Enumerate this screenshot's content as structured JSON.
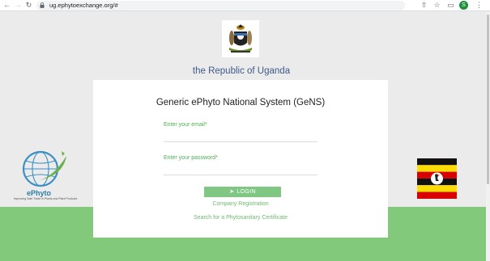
{
  "browser": {
    "url": "ug.ephytoexchange.org/#",
    "avatar_letter": "S",
    "icons": [
      "back-icon",
      "forward-icon",
      "reload-icon",
      "lock-icon",
      "share-icon",
      "star-icon",
      "sidebar-icon",
      "menu-icon"
    ]
  },
  "header": {
    "country_text": "the Republic of Uganda"
  },
  "login": {
    "title": "Generic ePhyto National System (GeNS)",
    "email_label": "Enter your email*",
    "password_label": "Enter your password*",
    "login_button": "LOGIN",
    "company_registration_link": "Company Registration",
    "search_certificate_link": "Search for a Phytosanitary Certificate"
  },
  "branding": {
    "ephyto_name": "ePhyto",
    "ephyto_tagline": "Improving Safe Trade in Plants and Plant Products"
  },
  "colors": {
    "accent_green": "#82c97b",
    "label_green": "#4caf50",
    "title_blue": "#3c5a8a",
    "button_green": "#81c784"
  }
}
